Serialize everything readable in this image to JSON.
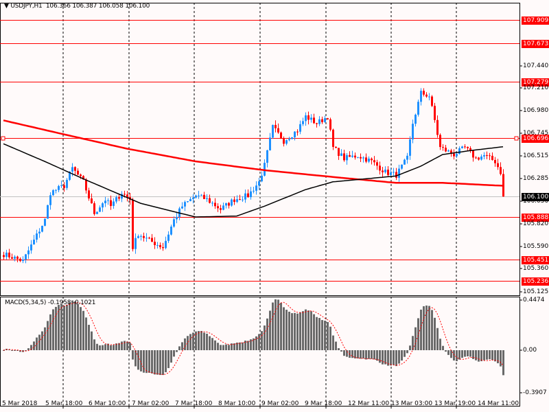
{
  "header": {
    "symbol": "USDJPY,H1",
    "ohlc": "106.366 106.387 106.058 106.100"
  },
  "macd": {
    "label": "MACD(5,34,5)",
    "values": "-0.1958 -0.1021",
    "max_label": "0.4474",
    "zero_label": "0.00",
    "min_label": "-0.3907"
  },
  "colors": {
    "background": "#fffafa",
    "bull": "#1e90ff",
    "bear": "#ff0000",
    "level_line": "#ff0000",
    "ma_slow": "#ff0000",
    "ma_fast": "#000000",
    "histogram": "#696969"
  },
  "price_ticks": [
    "107.440",
    "107.210",
    "106.980",
    "106.745",
    "106.515",
    "106.285",
    "106.050",
    "105.820",
    "105.590",
    "105.360",
    "105.125"
  ],
  "level_lines": [
    "107.909",
    "107.673",
    "107.279",
    "106.696",
    "105.888",
    "105.451",
    "105.236"
  ],
  "current_price": "106.100",
  "time_labels": [
    "5 Mar 2018",
    "5 Mar 18:00",
    "6 Mar 10:00",
    "7 Mar 02:00",
    "7 Mar 18:00",
    "8 Mar 10:00",
    "9 Mar 02:00",
    "9 Mar 18:00",
    "12 Mar 11:00",
    "13 Mar 03:00",
    "13 Mar 19:00",
    "14 Mar 11:00"
  ],
  "chart_data": {
    "type": "candlestick",
    "symbol": "USDJPY",
    "timeframe": "H1",
    "bars": 183,
    "price_range": [
      105.125,
      107.909
    ],
    "close_keypoints": [
      [
        0,
        105.51
      ],
      [
        7,
        105.44
      ],
      [
        11,
        105.65
      ],
      [
        15,
        105.86
      ],
      [
        17,
        106.14
      ],
      [
        22,
        106.21
      ],
      [
        25,
        106.39
      ],
      [
        29,
        106.25
      ],
      [
        33,
        105.93
      ],
      [
        37,
        106.07
      ],
      [
        39,
        106.0
      ],
      [
        43,
        106.14
      ],
      [
        46,
        106.07
      ],
      [
        47,
        105.58
      ],
      [
        49,
        105.72
      ],
      [
        53,
        105.65
      ],
      [
        58,
        105.58
      ],
      [
        62,
        105.86
      ],
      [
        65,
        106.0
      ],
      [
        70,
        106.11
      ],
      [
        74,
        106.07
      ],
      [
        79,
        105.97
      ],
      [
        84,
        106.07
      ],
      [
        89,
        106.11
      ],
      [
        93,
        106.25
      ],
      [
        95,
        106.42
      ],
      [
        98,
        106.81
      ],
      [
        102,
        106.67
      ],
      [
        107,
        106.78
      ],
      [
        110,
        106.92
      ],
      [
        114,
        106.85
      ],
      [
        118,
        106.92
      ],
      [
        120,
        106.6
      ],
      [
        124,
        106.49
      ],
      [
        129,
        106.52
      ],
      [
        134,
        106.46
      ],
      [
        139,
        106.35
      ],
      [
        143,
        106.32
      ],
      [
        147,
        106.49
      ],
      [
        149,
        106.85
      ],
      [
        152,
        107.16
      ],
      [
        155,
        107.13
      ],
      [
        157,
        106.88
      ],
      [
        159,
        106.6
      ],
      [
        164,
        106.53
      ],
      [
        168,
        106.6
      ],
      [
        172,
        106.49
      ],
      [
        175,
        106.52
      ],
      [
        179,
        106.46
      ],
      [
        181,
        106.35
      ],
      [
        182,
        106.1
      ]
    ],
    "ma_slow_keypoints": [
      [
        0,
        106.88
      ],
      [
        20,
        106.75
      ],
      [
        45,
        106.59
      ],
      [
        70,
        106.46
      ],
      [
        95,
        106.37
      ],
      [
        120,
        106.3
      ],
      [
        143,
        106.24
      ],
      [
        160,
        106.24
      ],
      [
        182,
        106.21
      ]
    ],
    "ma_fast_keypoints": [
      [
        0,
        106.64
      ],
      [
        15,
        106.46
      ],
      [
        30,
        106.27
      ],
      [
        50,
        106.03
      ],
      [
        70,
        105.89
      ],
      [
        85,
        105.9
      ],
      [
        95,
        106.0
      ],
      [
        110,
        106.17
      ],
      [
        120,
        106.25
      ],
      [
        143,
        106.31
      ],
      [
        152,
        106.41
      ],
      [
        160,
        106.53
      ],
      [
        170,
        106.57
      ],
      [
        182,
        106.61
      ]
    ],
    "macd_range": [
      -0.3907,
      0.4474
    ]
  }
}
